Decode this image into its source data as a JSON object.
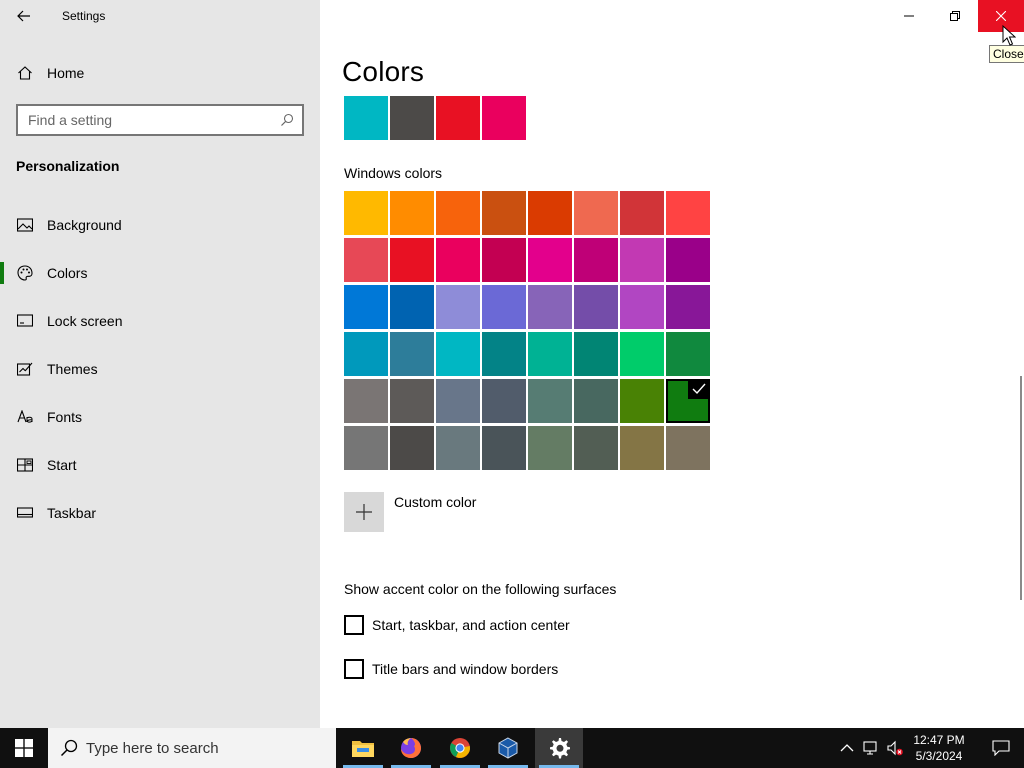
{
  "window": {
    "title": "Settings",
    "close_tooltip": "Close"
  },
  "sidebar": {
    "home_label": "Home",
    "search_placeholder": "Find a setting",
    "section_title": "Personalization",
    "items": [
      {
        "label": "Background",
        "icon": "picture-icon"
      },
      {
        "label": "Colors",
        "icon": "palette-icon",
        "active": true
      },
      {
        "label": "Lock screen",
        "icon": "lock-screen-icon"
      },
      {
        "label": "Themes",
        "icon": "themes-icon"
      },
      {
        "label": "Fonts",
        "icon": "fonts-icon"
      },
      {
        "label": "Start",
        "icon": "start-icon"
      },
      {
        "label": "Taskbar",
        "icon": "taskbar-icon"
      }
    ]
  },
  "main": {
    "title": "Colors",
    "recent_colors": [
      "#00b7c3",
      "#4c4a48",
      "#e81123",
      "#ea005e"
    ],
    "windows_colors_label": "Windows colors",
    "windows_colors": [
      [
        "#ffb900",
        "#ff8c00",
        "#f7630c",
        "#ca5010",
        "#da3b01",
        "#ef6950",
        "#d13438",
        "#ff4343"
      ],
      [
        "#e74856",
        "#e81123",
        "#ea005e",
        "#c30052",
        "#e3008c",
        "#bf0077",
        "#c239b3",
        "#9a0089"
      ],
      [
        "#0078d7",
        "#0063b1",
        "#8e8cd8",
        "#6b69d6",
        "#8764b8",
        "#744da9",
        "#b146c2",
        "#881798"
      ],
      [
        "#0099bc",
        "#2d7d9a",
        "#00b7c3",
        "#038387",
        "#00b294",
        "#018574",
        "#00cc6a",
        "#10893e"
      ],
      [
        "#7a7574",
        "#5d5a58",
        "#68768a",
        "#515c6b",
        "#567c73",
        "#486860",
        "#498205",
        "#107c10"
      ],
      [
        "#767676",
        "#4c4a48",
        "#69797e",
        "#4a5459",
        "#647c64",
        "#525e54",
        "#847545",
        "#7e735f"
      ]
    ],
    "selected_color": "#107c10",
    "custom_color_label": "Custom color",
    "surfaces_label": "Show accent color on the following surfaces",
    "checkboxes": [
      {
        "label": "Start, taskbar, and action center",
        "checked": false
      },
      {
        "label": "Title bars and window borders",
        "checked": false
      }
    ]
  },
  "taskbar": {
    "search_placeholder": "Type here to search",
    "apps": [
      "file-explorer-icon",
      "firefox-icon",
      "chrome-icon",
      "virtualbox-icon",
      "settings-gear-icon"
    ],
    "time": "12:47 PM",
    "date": "5/3/2024"
  },
  "colors": {
    "accent": "#107c10",
    "close_red": "#e81123",
    "sidebar_bg": "#e6e6e6",
    "taskbar_bg": "#101010"
  }
}
